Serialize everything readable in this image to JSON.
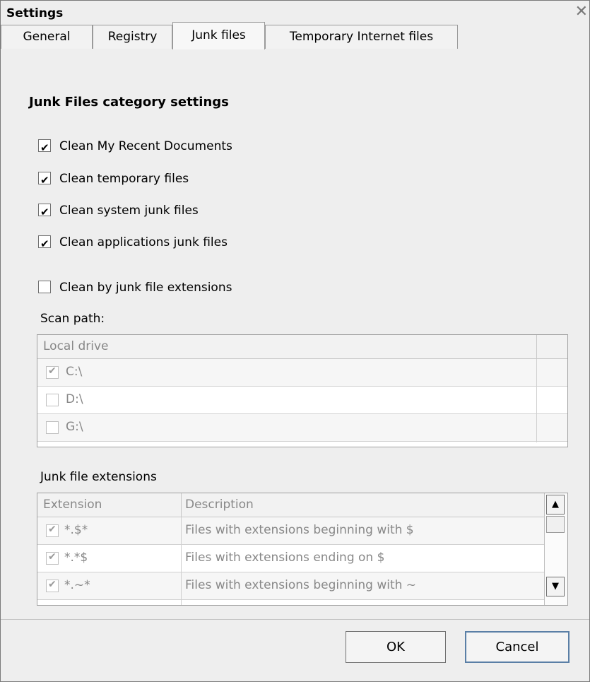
{
  "window": {
    "title": "Settings",
    "close_glyph": "✕"
  },
  "tabs": [
    {
      "label": "General",
      "active": false
    },
    {
      "label": "Registry",
      "active": false
    },
    {
      "label": "Junk files",
      "active": true
    },
    {
      "label": "Temporary Internet files",
      "active": false
    }
  ],
  "panel": {
    "heading": "Junk Files category settings",
    "options": [
      {
        "label": "Clean My Recent Documents",
        "checked": true
      },
      {
        "label": "Clean temporary files",
        "checked": true
      },
      {
        "label": "Clean system junk files",
        "checked": true
      },
      {
        "label": "Clean applications junk files",
        "checked": true
      },
      {
        "label": "Clean by junk file extensions",
        "checked": false
      }
    ],
    "scan_path_label": "Scan path:",
    "drives": {
      "header": "Local drive",
      "rows": [
        {
          "label": "C:\\",
          "checked": true
        },
        {
          "label": "D:\\",
          "checked": false
        },
        {
          "label": "G:\\",
          "checked": false
        }
      ]
    },
    "extensions_label": "Junk file extensions",
    "extensions": {
      "headers": {
        "extension": "Extension",
        "description": "Description"
      },
      "rows": [
        {
          "ext": "*.$*",
          "desc": "Files with extensions beginning with $",
          "checked": true
        },
        {
          "ext": "*.*$",
          "desc": "Files with extensions ending on $",
          "checked": true
        },
        {
          "ext": "*.~*",
          "desc": "Files with extensions beginning with ~",
          "checked": true
        }
      ]
    }
  },
  "buttons": {
    "ok": "OK",
    "cancel": "Cancel"
  },
  "icons": {
    "scroll_up": "▲",
    "scroll_down": "▼"
  }
}
